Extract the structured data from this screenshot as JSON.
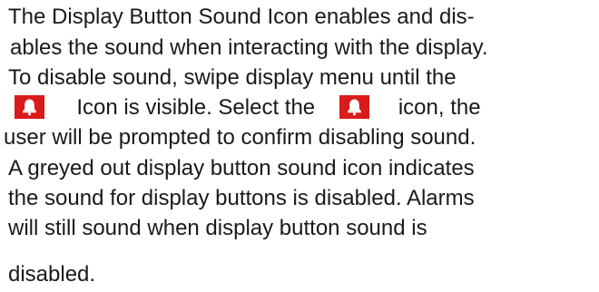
{
  "doc": {
    "lines": [
      "The Display Button Sound Icon enables and dis-",
      "ables the sound when interacting with the display.",
      "To disable sound, swipe display menu until the",
      "Icon is visible. Select the",
      "icon, the",
      "user will be prompted to confirm disabling sound.",
      "A greyed out display button sound icon indicates",
      "the sound for display buttons is disabled. Alarms",
      "will still sound when display button sound is",
      "disabled."
    ]
  },
  "icons": {
    "bell_icon_color": "#d91b1b",
    "bell_icon_name": "bell-icon"
  }
}
